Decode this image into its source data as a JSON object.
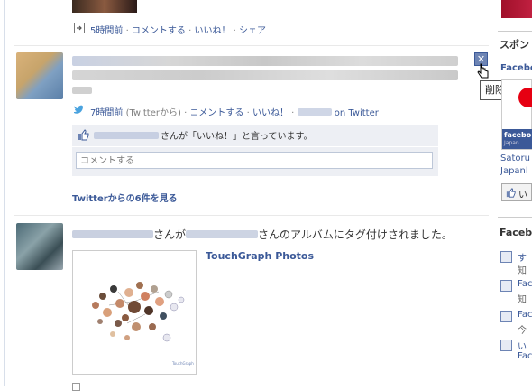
{
  "colors": {
    "link": "#3b5998",
    "accent_blue": "#6d84b4",
    "bg_light": "#edeff4"
  },
  "post0": {
    "time": "5時間前",
    "actions": [
      "コメントする",
      "いいね！",
      "シェア"
    ]
  },
  "post1": {
    "time": "7時間前",
    "via": "(Twitterから)",
    "actions": [
      "コメントする",
      "いいね！"
    ],
    "on_twitter": "on Twitter",
    "like_text": "さんが「いいね！」と言っています。",
    "comment_placeholder": "コメントする",
    "more_link": "Twitterからの6件を見る",
    "delete_tooltip": "削除"
  },
  "post2": {
    "story_mid": "さんが",
    "story_end": "さんのアルバムにタグ付けされました。",
    "album_title": "TouchGraph Photos"
  },
  "sidebar": {
    "sponsored": "スポン",
    "fb_header": "Facebo",
    "ad_brand": "facebo",
    "ad_sub": "Japan",
    "satoru": "Satoru",
    "japanl": "Japanl",
    "like_btn": "い",
    "section2": "Facebo",
    "items": [
      {
        "label": "す",
        "sub": "知"
      },
      {
        "label": "Fac",
        "sub": "知"
      },
      {
        "label": "Fac",
        "sub": "今"
      },
      {
        "label": "い",
        "sub": "Fac"
      }
    ]
  }
}
